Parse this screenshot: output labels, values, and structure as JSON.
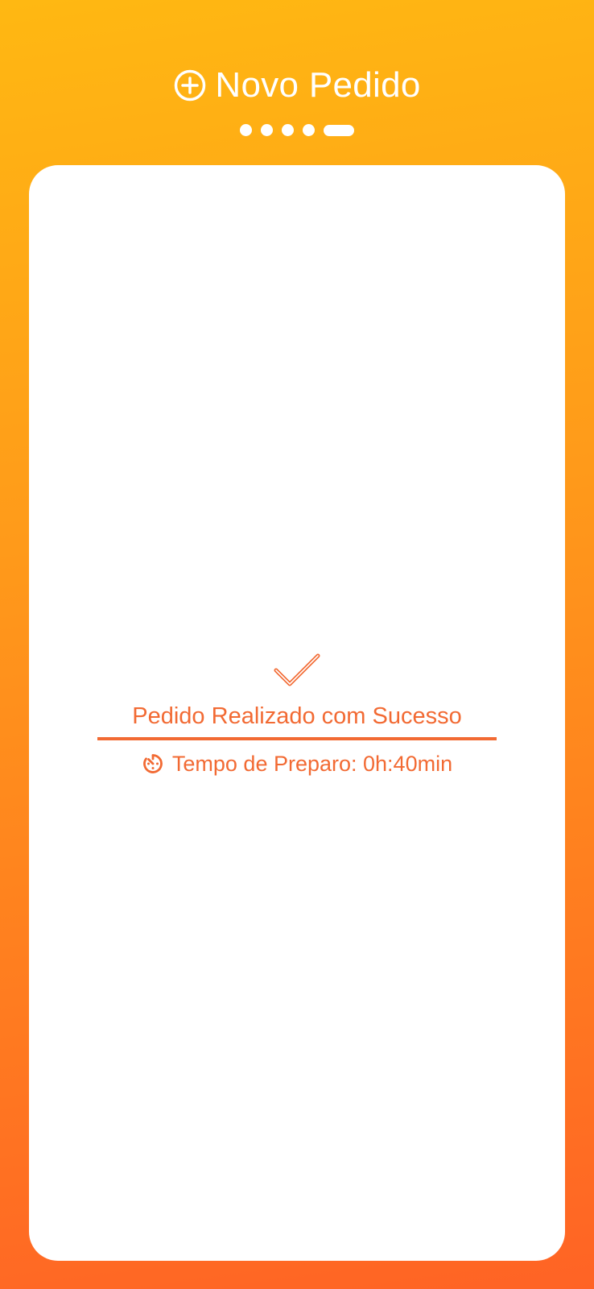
{
  "header": {
    "icon": "plus-circle-icon",
    "title": "Novo Pedido"
  },
  "stepper": {
    "total_steps": 5,
    "current_step": 5
  },
  "confirmation": {
    "icon": "check-icon",
    "title": "Pedido Realizado com Sucesso",
    "prep_icon": "timer-icon",
    "prep_time": "Tempo de Preparo: 0h:40min"
  },
  "colors": {
    "gradient_top": "#FFB812",
    "gradient_bottom": "#FF6325",
    "accent": "#F26A33",
    "card": "#FFFFFF"
  }
}
